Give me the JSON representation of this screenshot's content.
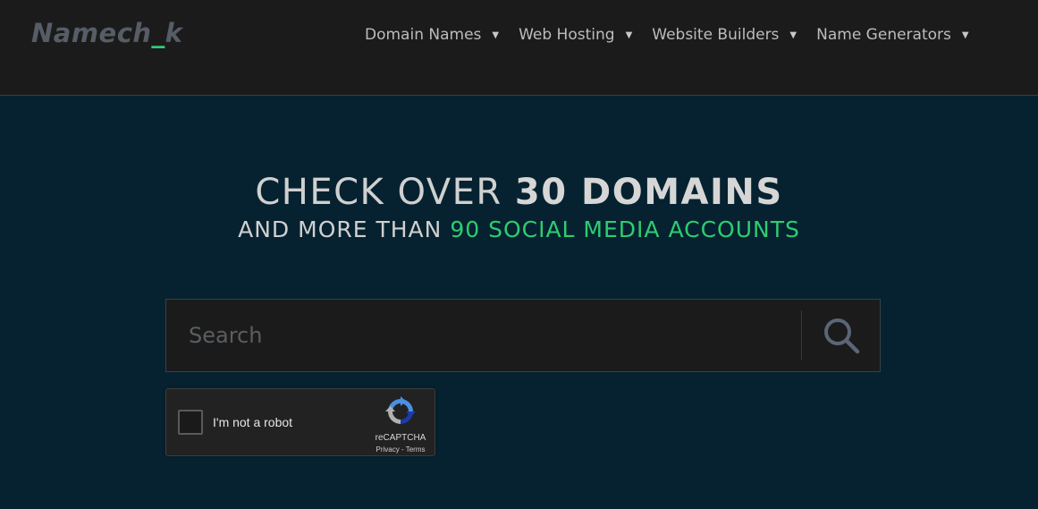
{
  "header": {
    "logo_main": "Namech",
    "logo_under": "_",
    "logo_end": "k",
    "nav": [
      {
        "label": "Domain Names"
      },
      {
        "label": "Web Hosting"
      },
      {
        "label": "Website Builders"
      },
      {
        "label": "Name Generators"
      }
    ]
  },
  "hero": {
    "line1_prefix": "CHECK OVER ",
    "line1_bold": "30 DOMAINS",
    "line2_prefix": "AND MORE THAN ",
    "line2_highlight": "90 SOCIAL MEDIA ACCOUNTS"
  },
  "search": {
    "placeholder": "Search",
    "value": ""
  },
  "captcha": {
    "label": "I'm not a robot",
    "brand": "reCAPTCHA",
    "privacy": "Privacy",
    "separator": " - ",
    "terms": "Terms"
  },
  "colors": {
    "header_bg": "#1b1b1b",
    "page_bg": "#062230",
    "accent_green": "#2ecc71",
    "logo_grey": "#565d66"
  }
}
